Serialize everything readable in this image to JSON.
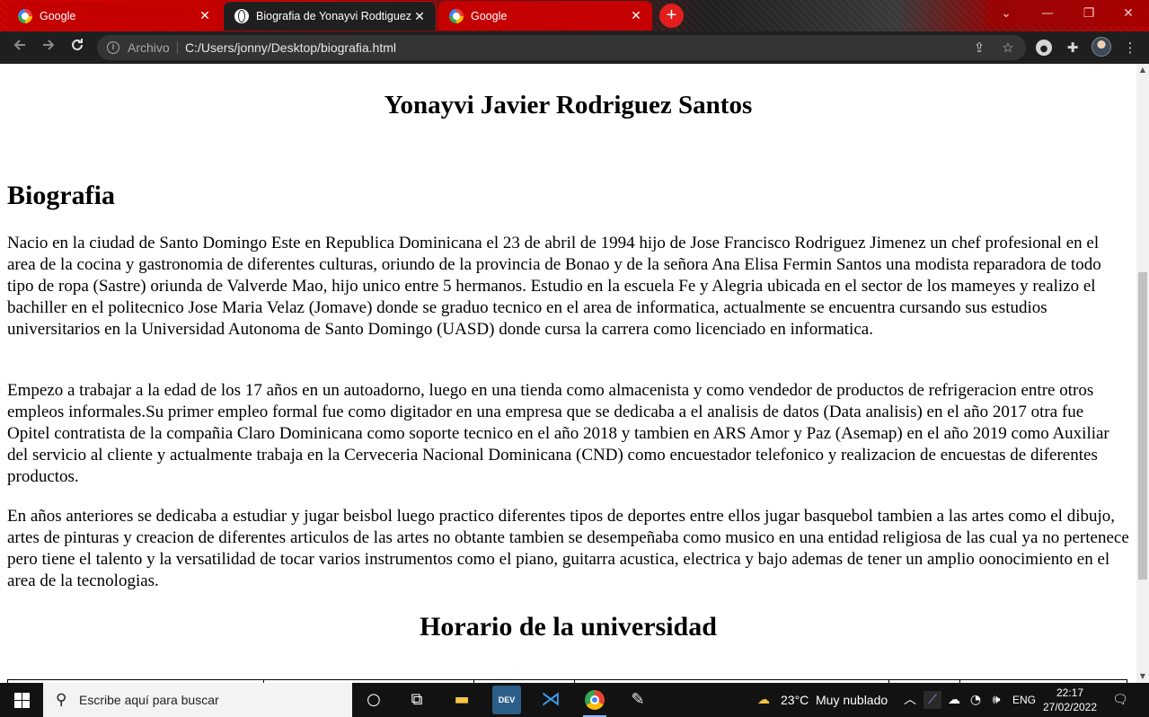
{
  "browser": {
    "tabs": [
      {
        "title": "Google",
        "favicon": "google-icon",
        "active": false
      },
      {
        "title": "Biografia de Yonayvi Rodtiguez",
        "favicon": "globe-icon",
        "active": true
      },
      {
        "title": "Google",
        "favicon": "google-icon",
        "active": false
      }
    ],
    "close_glyph": "✕",
    "new_tab_glyph": "+",
    "window_controls": {
      "tab_search": "⌄",
      "minimize": "—",
      "restore": "❐",
      "close": "✕"
    },
    "address": {
      "scheme_label": "Archivo",
      "url": "C:/Users/jonny/Desktop/biografia.html"
    }
  },
  "page": {
    "title": "Yonayvi Javier Rodriguez Santos",
    "section_heading": "Biografia",
    "paragraphs": [
      "Nacio en la ciudad de Santo Domingo Este en Republica Dominicana el 23 de abril de 1994 hijo de Jose Francisco Rodriguez Jimenez un chef profesional en el area de la cocina y gastronomia de diferentes culturas, oriundo de la provincia de Bonao y de la señora Ana Elisa Fermin Santos una modista reparadora de todo tipo de ropa (Sastre) oriunda de Valverde Mao, hijo unico entre 5 hermanos. Estudio en la escuela Fe y Alegria ubicada en el sector de los mameyes y realizo el bachiller en el politecnico Jose Maria Velaz (Jomave) donde se graduo tecnico en el area de informatica, actualmente se encuentra cursando sus estudios universitarios en la Universidad Autonoma de Santo Domingo (UASD) donde cursa la carrera como licenciado en informatica.",
      "Empezo a trabajar a la edad de los 17 años en un autoadorno, luego en una tienda como almacenista y como vendedor de productos de refrigeracion entre otros empleos informales.Su primer empleo formal fue como digitador en una empresa que se dedicaba a el analisis de datos (Data analisis) en el año 2017 otra fue Opitel contratista de la compañia Claro Dominicana como soporte tecnico en el año 2018 y tambien en ARS Amor y Paz (Asemap) en el año 2019 como Auxiliar del servicio al cliente y actualmente trabaja en la Cerveceria Nacional Dominicana (CND) como encuestador telefonico y realizacion de encuestas de diferentes productos.",
      "En años anteriores se dedicaba a estudiar y jugar beisbol luego practico diferentes tipos de deportes entre ellos jugar basquebol tambien a las artes como el dibujo, artes de pinturas y creacion de diferentes articulos de las artes no obtante tambien se desempeñaba como musico en una entidad religiosa de las cual ya no pertenece pero tiene el talento y la versatilidad de tocar varios instrumentos como el piano, guitarra acustica, electrica y bajo ademas de tener un amplio oonocimiento en el area de la tecnologias."
    ],
    "schedule_heading": "Horario de la universidad"
  },
  "taskbar": {
    "search_placeholder": "Escribe aquí para buscar",
    "weather_temp": "23°C",
    "weather_desc": "Muy nublado",
    "language": "ENG",
    "time": "22:17",
    "date": "27/02/2022",
    "dev_label": "DEV"
  }
}
